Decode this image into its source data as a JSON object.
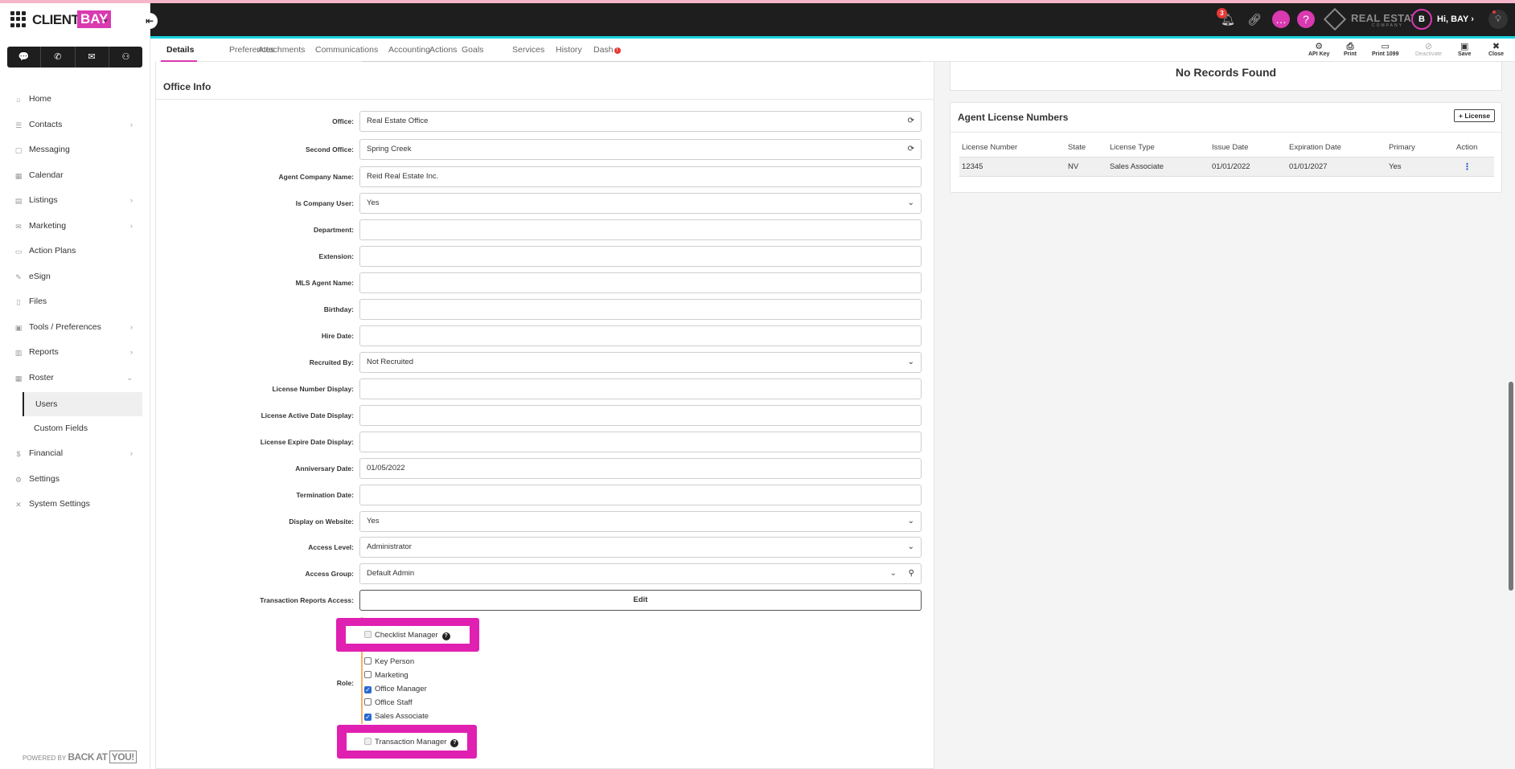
{
  "app": {
    "logo_client": "CLIENT",
    "logo_bay": "BAY",
    "brand_accent": "#d93ab0",
    "highlight_color": "#e020b0"
  },
  "topbar": {
    "notification_count": "3",
    "company_logo_text": "REAL ESTATE",
    "company_logo_sub": "COMPANY",
    "avatar_letter": "B",
    "greeting": "Hi, BAY",
    "icons": [
      "bell-icon",
      "link-icon",
      "chat-icon",
      "help-icon",
      "lightbulb-icon"
    ]
  },
  "quick_actions": [
    "chat-icon",
    "phone-icon",
    "mail-icon",
    "add-contact-icon"
  ],
  "sidebar": {
    "items": [
      {
        "label": "Home",
        "icon": "home-icon",
        "chevron": ""
      },
      {
        "label": "Contacts",
        "icon": "contacts-icon",
        "chevron": "›"
      },
      {
        "label": "Messaging",
        "icon": "message-icon",
        "chevron": ""
      },
      {
        "label": "Calendar",
        "icon": "calendar-icon",
        "chevron": ""
      },
      {
        "label": "Listings",
        "icon": "listings-icon",
        "chevron": "›"
      },
      {
        "label": "Marketing",
        "icon": "marketing-icon",
        "chevron": "›"
      },
      {
        "label": "Action Plans",
        "icon": "action-plans-icon",
        "chevron": ""
      },
      {
        "label": "eSign",
        "icon": "pen-icon",
        "chevron": ""
      },
      {
        "label": "Files",
        "icon": "file-icon",
        "chevron": ""
      },
      {
        "label": "Tools / Preferences",
        "icon": "tools-icon",
        "chevron": "›"
      },
      {
        "label": "Reports",
        "icon": "reports-icon",
        "chevron": "›"
      },
      {
        "label": "Roster",
        "icon": "roster-icon",
        "chevron": "⌄"
      }
    ],
    "sub_items": [
      {
        "label": "Users",
        "active": true
      },
      {
        "label": "Custom Fields",
        "active": false
      }
    ],
    "items_after": [
      {
        "label": "Financial",
        "icon": "dollar-icon",
        "chevron": "›"
      },
      {
        "label": "Settings",
        "icon": "gear-icon",
        "chevron": ""
      },
      {
        "label": "System Settings",
        "icon": "wrench-icon",
        "chevron": ""
      }
    ],
    "powered_by": "POWERED BY",
    "powered_back": "BACK AT",
    "powered_you": "YOU!"
  },
  "tabs": [
    "Details",
    "Preferences",
    "Attachments",
    "Communications",
    "Accounting",
    "Actions",
    "Goals",
    "Services",
    "History",
    "Dash"
  ],
  "toolbar": [
    {
      "label": "API Key",
      "icon": "gear-icon",
      "disabled": false
    },
    {
      "label": "Print",
      "icon": "print-icon",
      "disabled": false
    },
    {
      "label": "Print 1099",
      "icon": "print-1099-icon",
      "disabled": false
    },
    {
      "label": "Deactivate",
      "icon": "deactivate-icon",
      "disabled": true
    },
    {
      "label": "Save",
      "icon": "save-icon",
      "disabled": false
    },
    {
      "label": "Close",
      "icon": "close-icon",
      "disabled": false
    }
  ],
  "office_info": {
    "title": "Office Info",
    "fields": [
      {
        "label": "Office:",
        "value": "Real Estate Office",
        "kind": "refresh"
      },
      {
        "label": "Second Office:",
        "value": "Spring Creek",
        "kind": "refresh"
      },
      {
        "label": "Agent Company Name:",
        "value": "Reid Real Estate Inc.",
        "kind": "text"
      },
      {
        "label": "Is Company User:",
        "value": "Yes",
        "kind": "select"
      },
      {
        "label": "Department:",
        "value": "",
        "kind": "text"
      },
      {
        "label": "Extension:",
        "value": "",
        "kind": "text"
      },
      {
        "label": "MLS Agent Name:",
        "value": "",
        "kind": "text"
      },
      {
        "label": "Birthday:",
        "value": "",
        "kind": "text"
      },
      {
        "label": "Hire Date:",
        "value": "",
        "kind": "text"
      },
      {
        "label": "Recruited By:",
        "value": "Not Recruited",
        "kind": "select"
      },
      {
        "label": "License Number Display:",
        "value": "",
        "kind": "text"
      },
      {
        "label": "License Active Date Display:",
        "value": "",
        "kind": "text"
      },
      {
        "label": "License Expire Date Display:",
        "value": "",
        "kind": "text"
      },
      {
        "label": "Anniversary Date:",
        "value": "01/05/2022",
        "kind": "text"
      },
      {
        "label": "Termination Date:",
        "value": "",
        "kind": "text"
      },
      {
        "label": "Display on Website:",
        "value": "Yes",
        "kind": "select"
      },
      {
        "label": "Access Level:",
        "value": "Administrator",
        "kind": "select"
      },
      {
        "label": "Access Group:",
        "value": "Default Admin",
        "kind": "select-search"
      },
      {
        "label": "Transaction Reports Access:",
        "value": "Edit",
        "kind": "button"
      }
    ],
    "role_label": "Role:",
    "roles": [
      {
        "label": "Checklist Manager",
        "checked": false,
        "disabled": true,
        "highlighted": true
      },
      {
        "label": "Key Person",
        "checked": false,
        "disabled": false,
        "highlighted": false
      },
      {
        "label": "Marketing",
        "checked": false,
        "disabled": false,
        "highlighted": false
      },
      {
        "label": "Office Manager",
        "checked": true,
        "disabled": false,
        "highlighted": false
      },
      {
        "label": "Office Staff",
        "checked": false,
        "disabled": false,
        "highlighted": false
      },
      {
        "label": "Sales Associate",
        "checked": true,
        "disabled": false,
        "highlighted": false
      },
      {
        "label": "Transaction Manager",
        "checked": false,
        "disabled": true,
        "highlighted": true
      }
    ]
  },
  "records_panel": {
    "empty_text": "No Records Found"
  },
  "license_panel": {
    "title": "Agent License Numbers",
    "add_button": "+ License",
    "columns": [
      "License Number",
      "State",
      "License Type",
      "Issue Date",
      "Expiration Date",
      "Primary",
      "Action"
    ],
    "rows": [
      {
        "license_number": "12345",
        "state": "NV",
        "license_type": "Sales Associate",
        "issue_date": "01/01/2022",
        "expiration_date": "01/01/2027",
        "primary": "Yes",
        "action": "⋮"
      }
    ]
  }
}
